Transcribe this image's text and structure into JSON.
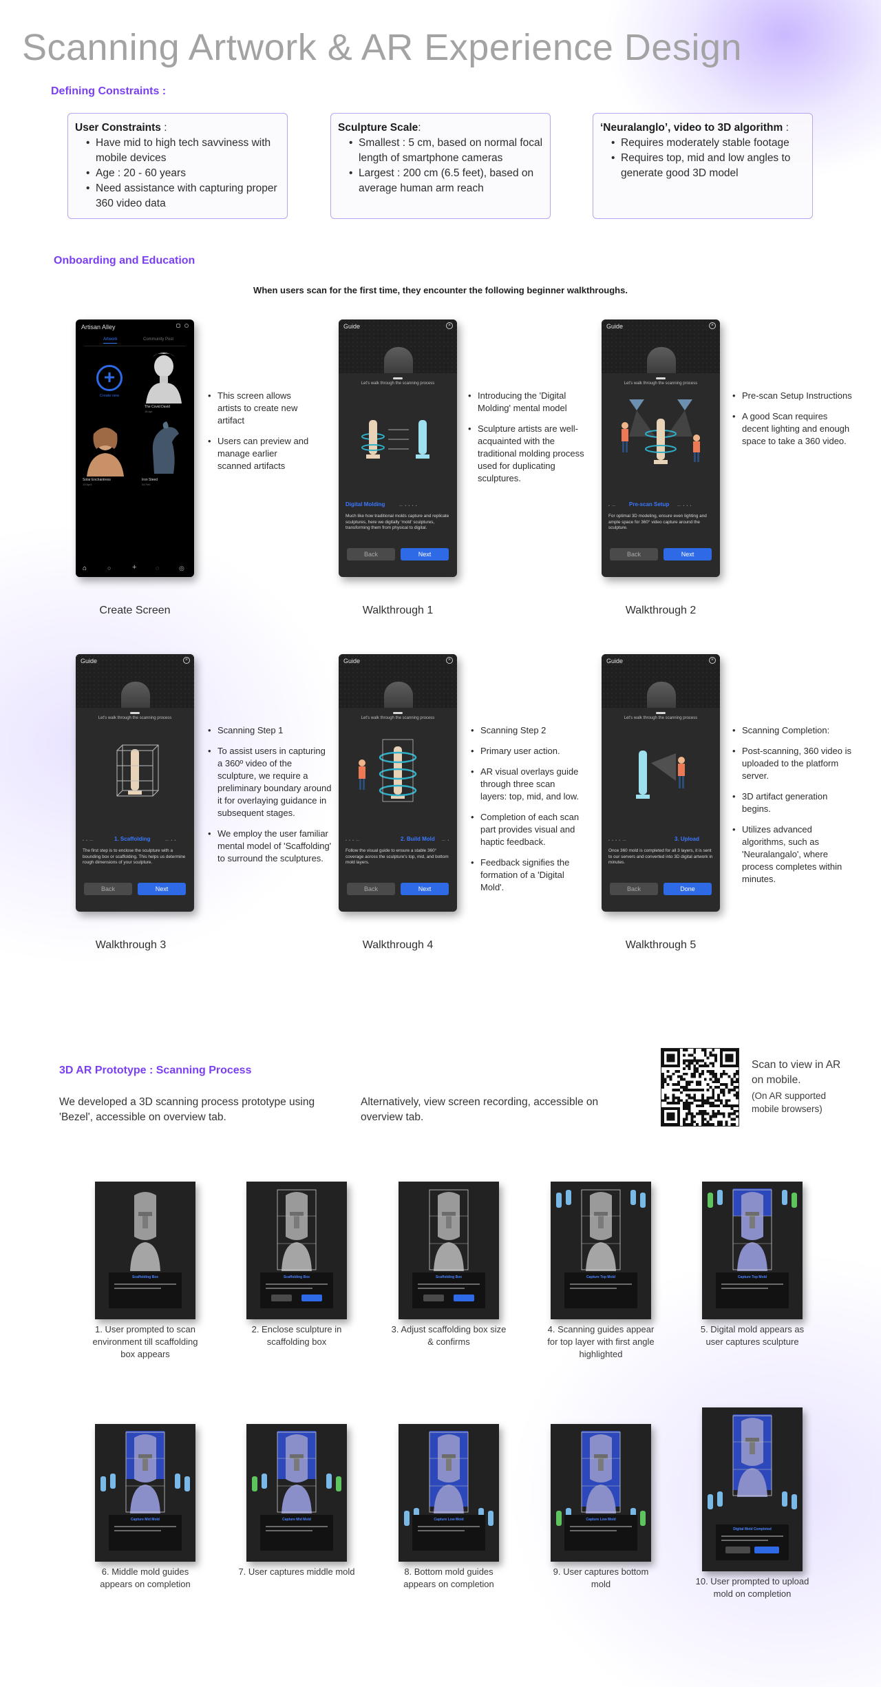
{
  "title": "Scanning Artwork & AR Experience Design",
  "constraints": {
    "heading": "Defining Constraints :",
    "cards": [
      {
        "title": "User Constraints",
        "suffix": " :",
        "items": [
          "Have mid to high tech savviness with mobile devices",
          "Age : 20 - 60 years",
          "Need assistance with capturing proper 360 video data"
        ]
      },
      {
        "title": "Sculpture Scale",
        "suffix": ":",
        "items": [
          "Smallest : 5 cm, based on normal focal length of smartphone cameras",
          "Largest : 200 cm (6.5 feet), based on average human arm reach"
        ]
      },
      {
        "title": "‘Neuralanglo’, video to 3D algorithm",
        "suffix": " :",
        "items": [
          "Requires moderately stable footage",
          "Requires top, mid and low angles to generate good 3D model"
        ]
      }
    ]
  },
  "onboarding": {
    "heading": "Onboarding and Education",
    "intro": "When users scan for the first time, they encounter the following beginner walkthroughs.",
    "create_screen": {
      "app_name": "Artisan Alley",
      "tabs": [
        "Artwork",
        "Community Post"
      ],
      "create_label": "Create new",
      "items": [
        {
          "name": "The Covid David",
          "meta": "18 Apr"
        },
        {
          "name": "Solar Enchantress",
          "meta": "19 April"
        },
        {
          "name": "Iron Steed",
          "meta": "04 Feb"
        }
      ],
      "caption": "Create Screen",
      "bullets": [
        "This screen allows artists to create new artifact",
        "Users can preview and manage earlier scanned artifacts"
      ]
    },
    "walkthroughs": [
      {
        "guide": "Guide",
        "walk": "Let's walk through the scanning process",
        "step": "Digital Molding",
        "desc": "Much like how traditional molds capture and replicate sculptures, here we digitally 'mold' sculptures, transforming them from physical to digital.",
        "back": "Back",
        "next": "Next",
        "caption": "Walkthrough 1",
        "bullets": [
          "Introducing the 'Digital Molding' mental model",
          "Sculpture artists are well-acquainted with the traditional molding process used for duplicating sculptures."
        ]
      },
      {
        "guide": "Guide",
        "walk": "Let's walk through the scanning process",
        "step": "Pre-scan Setup",
        "desc": "For optimal 3D modeling, ensure even lighting and ample space for 360° video capture around the sculpture.",
        "back": "Back",
        "next": "Next",
        "caption": "Walkthrough 2",
        "bullets": [
          "Pre-scan Setup Instructions",
          "A good Scan requires decent lighting and enough space to take a 360 video."
        ]
      },
      {
        "guide": "Guide",
        "walk": "Let's walk through the scanning process",
        "step": "1. Scaffolding",
        "desc": "The first step is to enclose the sculpture with a bounding box or scaffolding. This helps us determine rough dimensions of your sculpture.",
        "back": "Back",
        "next": "Next",
        "caption": "Walkthrough 3",
        "bullets": [
          "Scanning Step 1",
          "To assist users in capturing a 360º video of the sculpture, we require a preliminary boundary around it for overlaying guidance in subsequent stages.",
          "We employ the user familiar mental model of 'Scaffolding' to surround the sculptures."
        ]
      },
      {
        "guide": "Guide",
        "walk": "Let's walk through the scanning process",
        "step": "2. Build Mold",
        "desc": "Follow the visual guide to ensure a stable 360° coverage across the sculpture's top, mid, and bottom mold layers.",
        "back": "Back",
        "next": "Next",
        "caption": "Walkthrough 4",
        "bullets": [
          "Scanning Step 2",
          "Primary user action.",
          "AR visual overlays guide through three scan layers: top, mid, and low.",
          "Completion of each scan part provides visual and haptic feedback.",
          "Feedback signifies the formation of a 'Digital Mold'."
        ]
      },
      {
        "guide": "Guide",
        "walk": "Let's walk through the scanning process",
        "step": "3. Upload",
        "desc": "Once 360 mold is completed for all 3 layers, it is sent to our servers and converted into 3D digital artwork in minutes.",
        "back": "Back",
        "next": "Done",
        "caption": "Walkthrough 5",
        "bullets": [
          "Scanning Completion:",
          "Post-scanning, 360 video is uploaded to the platform server.",
          "3D artifact generation begins.",
          "Utilizes advanced algorithms, such as 'Neuralangalo', where process completes within minutes."
        ]
      }
    ]
  },
  "prototype": {
    "heading": "3D AR Prototype : Scanning Process",
    "text_left": "We developed a 3D scanning process prototype using 'Bezel', accessible on overview tab.",
    "text_right": "Alternatively, view screen recording, accessible on overview tab.",
    "qr_text": "Scan to view in AR on mobile.",
    "qr_note": "(On AR supported mobile browsers)",
    "steps": [
      {
        "caption": "1. User prompted to scan environment till scaffolding box appears",
        "panel": "Scaffolding Box"
      },
      {
        "caption": "2. Enclose sculpture in scaffolding box",
        "panel": "Scaffolding Box"
      },
      {
        "caption": "3. Adjust scaffolding box size & confirms",
        "panel": "Scaffolding Box"
      },
      {
        "caption": "4. Scanning guides appear for top layer with first angle highlighted",
        "panel": "Capture Top Mold"
      },
      {
        "caption": "5. Digital mold appears as user captures sculpture",
        "panel": "Capture Top Mold"
      },
      {
        "caption": "6. Middle mold guides appears on completion",
        "panel": "Capture Mid Mold"
      },
      {
        "caption": "7. User captures middle mold",
        "panel": "Capture Mid Mold"
      },
      {
        "caption": "8. Bottom mold guides appears on completion",
        "panel": "Capture Low Mold"
      },
      {
        "caption": "9. User captures bottom mold",
        "panel": "Capture Low Mold"
      },
      {
        "caption": "10. User prompted to upload mold on completion",
        "panel": "Digital Mold Completed"
      }
    ]
  },
  "colors": {
    "accent": "#7b3ff2",
    "blue": "#2f6ae6",
    "phone_bg": "#2a2a2b"
  }
}
